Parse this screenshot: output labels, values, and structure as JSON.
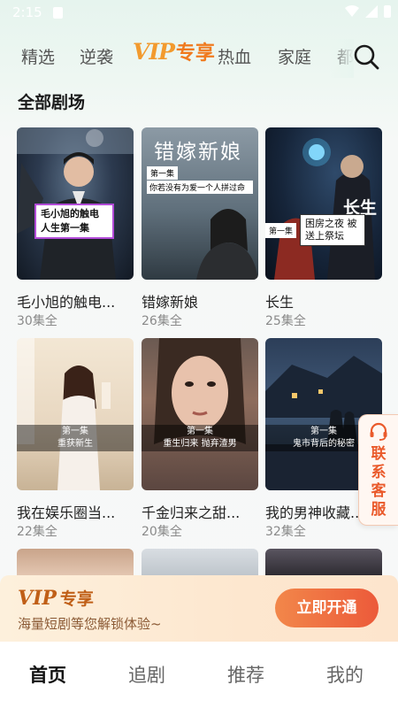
{
  "status_bar": {
    "time": "2:15"
  },
  "top_tabs": {
    "items": [
      "精选",
      "逆袭",
      "热血",
      "家庭",
      "都"
    ],
    "vip_logo": "VIP",
    "vip_label": "专享"
  },
  "section_title": "全部剧场",
  "cards": [
    {
      "title": "毛小旭的触电...",
      "count": "30集全",
      "badge": "毛小旭的触电人生第一集"
    },
    {
      "title": "错嫁新娘",
      "count": "26集全",
      "poster_title": "错嫁新娘",
      "badge_ep": "第一集",
      "badge_line": "你若没有为爱一个人拼过命"
    },
    {
      "title": "长生",
      "count": "25集全",
      "poster_title": "长生",
      "badge_ep": "第一集",
      "badge_line": "困房之夜 被送上祭坛"
    },
    {
      "title": "我在娱乐圈当...",
      "count": "22集全",
      "badge_ep": "第一集",
      "badge_line": "重获新生"
    },
    {
      "title": "千金归来之甜...",
      "count": "20集全",
      "badge_ep": "第一集",
      "badge_line": "重生归来 抛弃渣男"
    },
    {
      "title": "我的男神收藏...",
      "count": "32集全",
      "badge_ep": "第一集",
      "badge_line": "鬼市背后的秘密"
    }
  ],
  "contact": {
    "label": "联系客服"
  },
  "vip_banner": {
    "logo": "VIP",
    "title": "专享",
    "subtitle": "海量短剧等您解锁体验~",
    "button": "立即开通"
  },
  "bottom_nav": {
    "items": [
      "首页",
      "追剧",
      "推荐",
      "我的"
    ],
    "active": "首页"
  },
  "colors": {
    "accent": "#ec5a3a",
    "vip": "#f29a2e"
  }
}
